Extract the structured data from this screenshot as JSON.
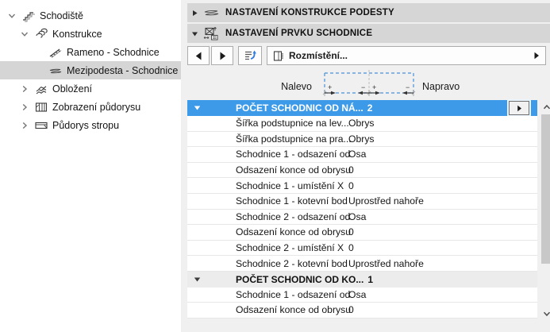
{
  "tree": {
    "items": [
      {
        "label": "Schodiště"
      },
      {
        "label": "Konstrukce"
      },
      {
        "label": "Rameno - Schodnice"
      },
      {
        "label": "Mezipodesta - Schodnice"
      },
      {
        "label": "Obložení"
      },
      {
        "label": "Zobrazení půdorysu"
      },
      {
        "label": "Půdorys stropu"
      }
    ]
  },
  "sections": [
    {
      "label": "NASTAVENÍ KONSTRUKCE PODESTY",
      "collapsed": true
    },
    {
      "label": "NASTAVENÍ PRVKU SCHODNICE",
      "collapsed": false
    }
  ],
  "toolbar": {
    "dropdown_label": "Rozmístění..."
  },
  "preview": {
    "left_label": "Nalevo",
    "right_label": "Napravo",
    "plus": "+",
    "minus": "−"
  },
  "table": {
    "groups": [
      {
        "label": "POČET SCHODNIC OD NÁ...",
        "value": "2",
        "rows": [
          {
            "label": "Šířka podstupnice na lev...",
            "value": "Obrys"
          },
          {
            "label": "Šířka podstupnice na pra...",
            "value": "Obrys"
          },
          {
            "label": "Schodnice 1 - odsazení od",
            "value": "Osa"
          },
          {
            "label": "Odsazení konce od obrysu",
            "value": "0"
          },
          {
            "label": "Schodnice 1 - umístění X",
            "value": "0"
          },
          {
            "label": "Schodnice 1 - kotevní bod",
            "value": "Uprostřed nahoře"
          },
          {
            "label": "Schodnice 2 - odsazení od",
            "value": "Osa"
          },
          {
            "label": "Odsazení konce od obrysu",
            "value": "0"
          },
          {
            "label": "Schodnice 2 - umístění X",
            "value": "0"
          },
          {
            "label": "Schodnice 2 - kotevní bod",
            "value": "Uprostřed nahoře"
          }
        ]
      },
      {
        "label": "POČET SCHODNIC OD KO...",
        "value": "1",
        "rows": [
          {
            "label": "Schodnice 1 - odsazení od",
            "value": "Osa"
          },
          {
            "label": "Odsazení konce od obrysu",
            "value": "0"
          }
        ]
      }
    ]
  },
  "colors": {
    "selection_blue": "#3d9ae8",
    "diagram_dash_blue": "#4a90d9",
    "section_header_gray": "#d6d6d6",
    "tree_selected_gray": "#d5d5d5"
  }
}
